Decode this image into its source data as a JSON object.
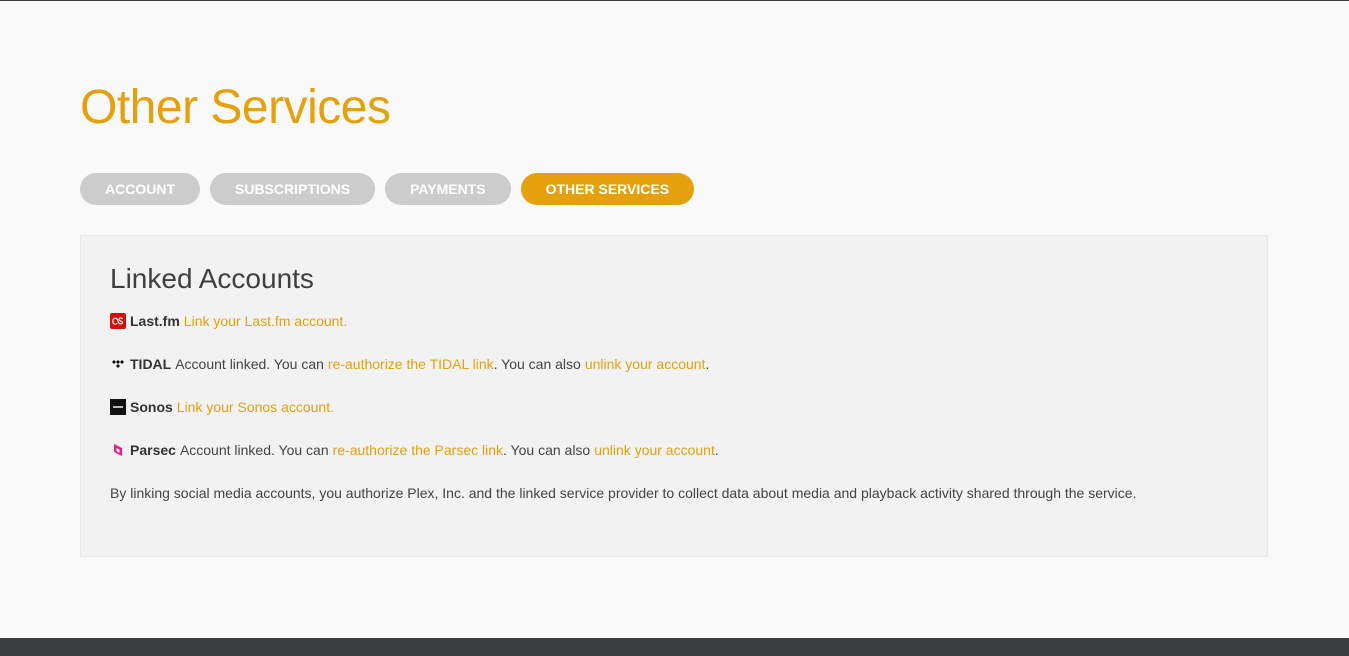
{
  "page": {
    "title": "Other Services"
  },
  "tabs": [
    {
      "label": "ACCOUNT",
      "active": false
    },
    {
      "label": "SUBSCRIPTIONS",
      "active": false
    },
    {
      "label": "PAYMENTS",
      "active": false
    },
    {
      "label": "OTHER SERVICES",
      "active": true
    }
  ],
  "linked_accounts": {
    "title": "Linked Accounts",
    "lastfm": {
      "icon": "lastfm-icon",
      "name": "Last.fm",
      "link": "Link your Last.fm account."
    },
    "tidal": {
      "icon": "tidal-icon",
      "name": "TIDAL",
      "text1": "Account linked. You can",
      "reauth_link": "re-authorize the TIDAL link",
      "text2": ". You can also",
      "unlink_link": "unlink your account",
      "text3": "."
    },
    "sonos": {
      "icon": "sonos-icon",
      "name": "Sonos",
      "link": "Link your Sonos account."
    },
    "parsec": {
      "icon": "parsec-icon",
      "name": "Parsec",
      "text1": "Account linked. You can",
      "reauth_link": "re-authorize the Parsec link",
      "text2": ". You can also",
      "unlink_link": "unlink your account",
      "text3": "."
    },
    "disclaimer": "By linking social media accounts, you authorize Plex, Inc. and the linked service provider to collect data about media and playback activity shared through the service."
  },
  "colors": {
    "accent": "#e5a00d",
    "tab_inactive": "#cccccc",
    "panel_bg": "#f2f2f2",
    "footer_bg": "#3b3e40",
    "lastfm_red": "#d51007",
    "parsec_pink": "#e0248f"
  }
}
